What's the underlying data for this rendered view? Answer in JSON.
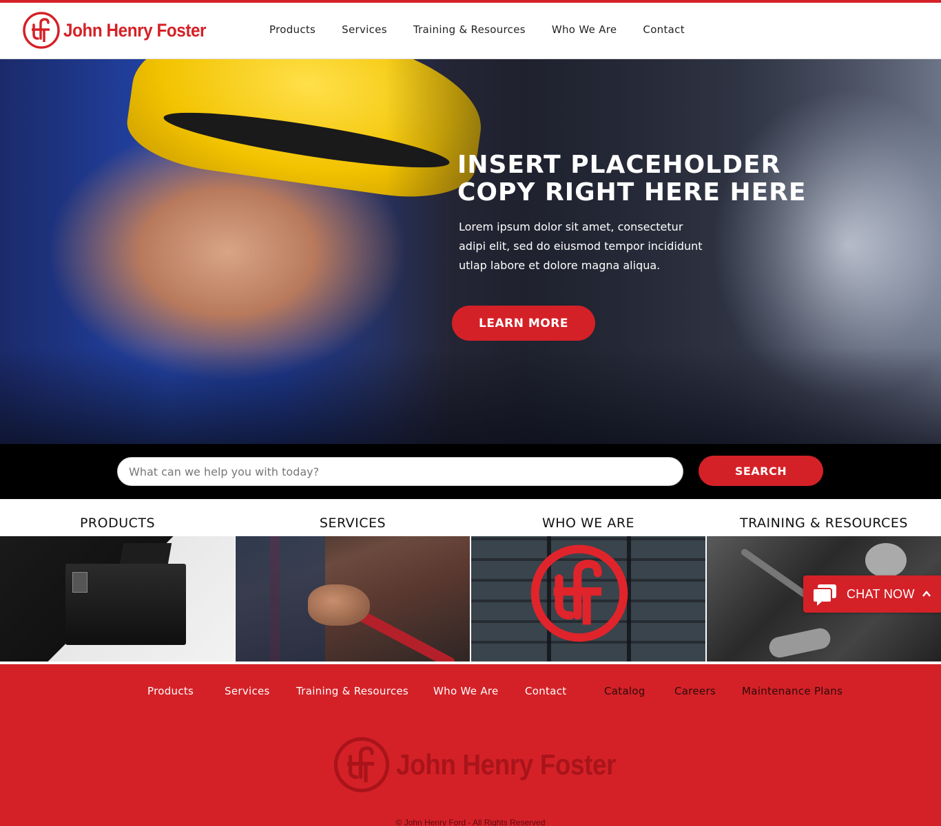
{
  "header": {
    "logo_text": "John Henry Foster",
    "nav": [
      "Products",
      "Services",
      "Training & Resources",
      "Who We Are",
      "Contact"
    ]
  },
  "hero": {
    "title_line1": "INSERT PLACEHOLDER",
    "title_line2": "COPY RIGHT HERE HERE",
    "body": "Lorem ipsum dolor sit amet, consectetur adipi elit, sed do eiusmod tempor incididunt utlap labore et dolore magna aliqua.",
    "button_label": "LEARN MORE"
  },
  "search": {
    "placeholder": "What can we help you with today?",
    "value": "",
    "button_label": "SEARCH"
  },
  "categories": [
    {
      "title": "PRODUCTS"
    },
    {
      "title": "SERVICES"
    },
    {
      "title": "WHO WE ARE"
    },
    {
      "title": "TRAINING & RESOURCES"
    }
  ],
  "chat": {
    "label": "CHAT NOW"
  },
  "footer": {
    "nav_primary": [
      "Products",
      "Services",
      "Training & Resources",
      "Who We Are",
      "Contact"
    ],
    "nav_secondary": [
      "Catalog",
      "Careers",
      "Maintenance Plans"
    ],
    "logo_text": "John Henry Foster",
    "copyright": "© John Henry Ford - All Rights Reserved"
  },
  "colors": {
    "brand_red": "#d42127",
    "search_band": "#000000",
    "footer_dark_text": "#2a0a0a"
  },
  "icons": {
    "logo": "jhf-monogram-icon",
    "chat": "chat-bubbles-icon",
    "chat_toggle": "chevron-up-icon"
  }
}
